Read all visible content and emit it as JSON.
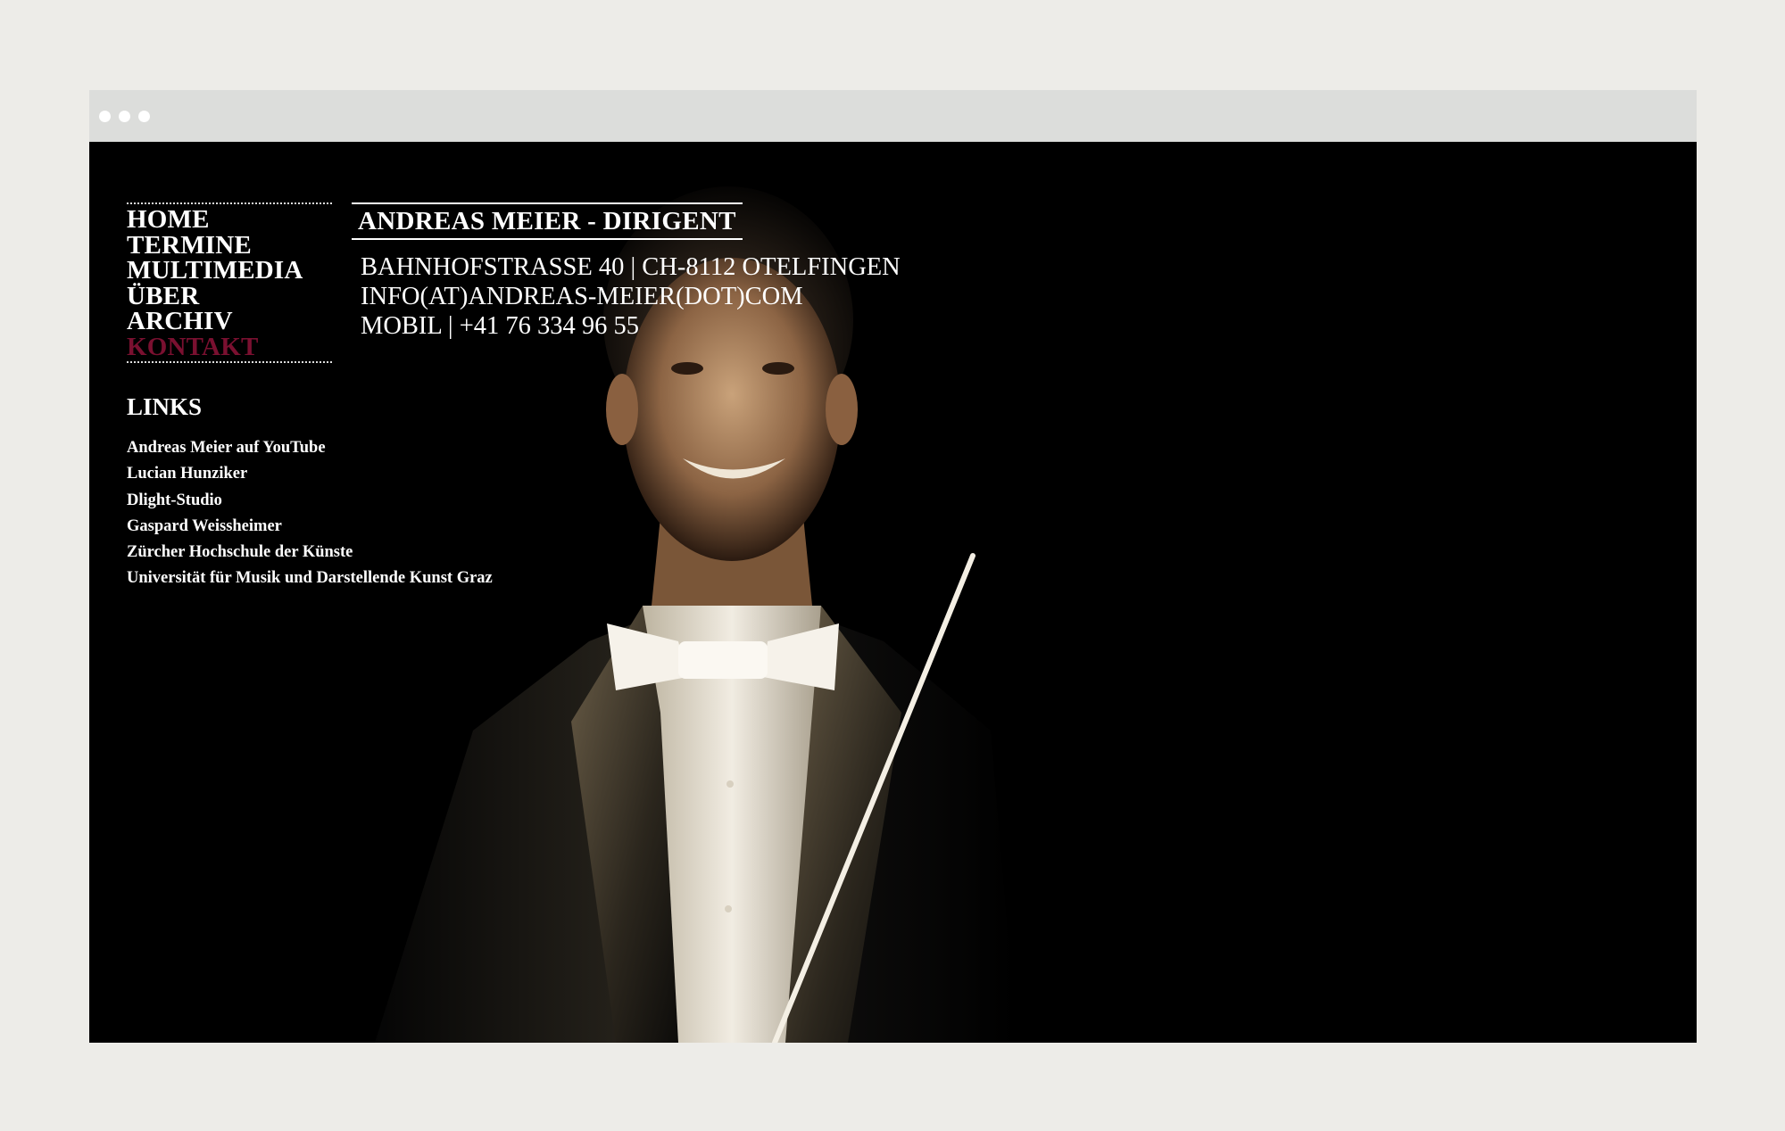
{
  "window": {
    "controls": [
      "close",
      "minimize",
      "maximize"
    ]
  },
  "colors": {
    "page_bg": "#edece8",
    "titlebar_bg": "#dcdddb",
    "site_bg": "#000000",
    "accent": "#7a1030",
    "text": "#ffffff"
  },
  "nav": {
    "items": [
      {
        "label": "HOME",
        "active": false
      },
      {
        "label": "TERMINE",
        "active": false
      },
      {
        "label": "MULTIMEDIA",
        "active": false
      },
      {
        "label": "ÜBER",
        "active": false
      },
      {
        "label": "ARCHIV",
        "active": false
      },
      {
        "label": "KONTAKT",
        "active": true
      }
    ]
  },
  "links": {
    "heading": "LINKS",
    "items": [
      "Andreas Meier auf YouTube",
      "Lucian Hunziker",
      "Dlight-Studio",
      "Gaspard Weissheimer",
      "Zürcher Hochschule der Künste",
      "Universität für Musik und Darstellende Kunst Graz"
    ]
  },
  "main": {
    "title": "ANDREAS MEIER - DIRIGENT",
    "contact": [
      "BAHNHOFSTRASSE 40 | CH-8112 OTELFINGEN",
      "INFO(AT)ANDREAS-MEIER(DOT)COM",
      "MOBIL | +41 76 334 96 55"
    ]
  }
}
